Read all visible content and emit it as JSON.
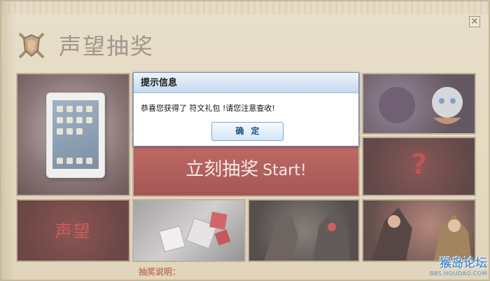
{
  "window": {
    "title": "声望抽奖",
    "close_label": "×"
  },
  "tiles": {
    "draw_label": "立刻抽奖",
    "draw_label_en": "Start!",
    "mystery_mark": "?",
    "prestige": "声望"
  },
  "rules": {
    "label": "抽奖说明："
  },
  "dialog": {
    "title": "提示信息",
    "message": "恭喜您获得了 符文礼包 !请您注意查收!",
    "confirm_label": "确定"
  },
  "watermark": {
    "site": "猴岛论坛",
    "url": "BBS.HOUDAO.COM"
  },
  "colors": {
    "accent_blue": "#2f78c8",
    "draw_red": "#b74a4a",
    "rules_label": "#b85a3a"
  }
}
